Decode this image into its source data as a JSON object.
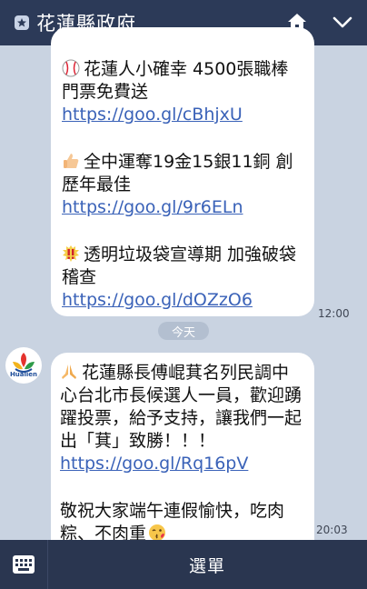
{
  "header": {
    "title": "花蓮縣政府",
    "icons": [
      "star-badge-icon",
      "home-icon",
      "chevron-down-icon"
    ]
  },
  "messages": [
    {
      "items": [
        {
          "emoji": "baseball-icon",
          "text": "花蓮人小確幸 4500張職棒門票免費送",
          "link": "https://goo.gl/cBhjxU"
        },
        {
          "emoji": "thumbs-up-icon",
          "text": "全中運奪19金15銀11銅 創歷年最佳",
          "link": "https://goo.gl/9r6ELn"
        },
        {
          "emoji": "double-exclamation-icon",
          "text": "透明垃圾袋宣導期 加強破袋稽查",
          "link": "https://goo.gl/dOZzO6"
        }
      ],
      "time": "12:00"
    },
    {
      "items": [
        {
          "emoji": "praying-hands-icon",
          "text": "花蓮縣長傅崐萁名列民調中心台北市長候選人一員，歡迎踴躍投票，給予支持，讓我們一起出「萁」致勝！！！",
          "link": "https://goo.gl/Rq16pV"
        },
        {
          "emoji": "kiss-face-icon",
          "text": "敬祝大家端午連假愉快，吃肉粽、不肉重"
        }
      ],
      "time": "20:03"
    }
  ],
  "date_separator": "今天",
  "avatar": {
    "label": "Hualien"
  },
  "footer": {
    "menu_label": "選單",
    "icons": [
      "keyboard-icon"
    ]
  },
  "colors": {
    "header_bg": "#2c3a58",
    "chat_bg": "#c9d3e1",
    "link": "#3a62b8",
    "footer_bg": "#2a3650"
  }
}
